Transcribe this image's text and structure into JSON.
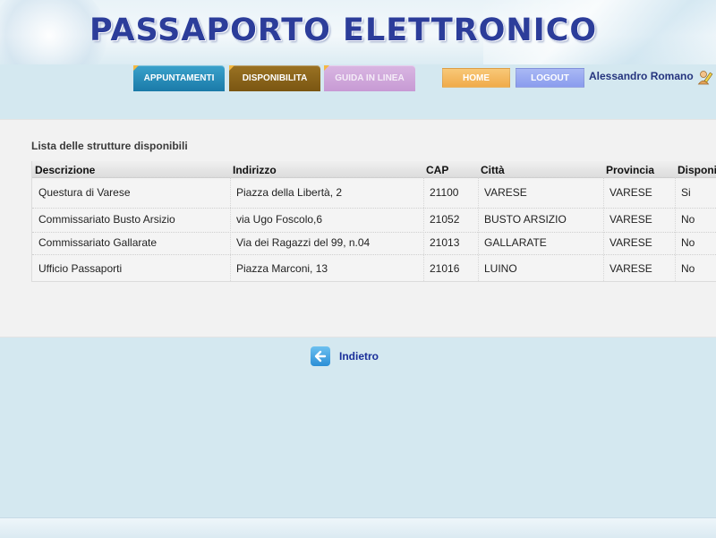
{
  "header": {
    "title": "PASSAPORTO ELETTRONICO"
  },
  "nav": {
    "tabs": [
      "APPUNTAMENTI",
      "DISPONIBILITA",
      "GUIDA IN LINEA"
    ],
    "home_label": "HOME",
    "logout_label": "LOGOUT",
    "user_name": "Alessandro Romano"
  },
  "main": {
    "section_title": "Lista delle strutture disponibili",
    "columns": [
      "Descrizione",
      "Indirizzo",
      "CAP",
      "Città",
      "Provincia",
      "Disponi"
    ],
    "rows": [
      [
        "Questura di Varese",
        "Piazza della Libertà, 2",
        "21100",
        "VARESE",
        "VARESE",
        "Si"
      ],
      [
        "Commissariato Busto Arsizio",
        "via Ugo Foscolo,6",
        "21052",
        "BUSTO ARSIZIO",
        "VARESE",
        "No"
      ],
      [
        "Commissariato Gallarate",
        "Via dei Ragazzi del 99, n.04",
        "21013",
        "GALLARATE",
        "VARESE",
        "No"
      ],
      [
        "Ufficio Passaporti",
        "Piazza Marconi, 13",
        "21016",
        "LUINO",
        "VARESE",
        "No"
      ]
    ]
  },
  "footer": {
    "back_label": "Indietro"
  },
  "icons": {
    "user": "user-pencil-icon",
    "back": "arrow-left-icon"
  },
  "colors": {
    "background": "#d4e8f0",
    "title": "#2c3d9a",
    "tab_appuntamenti": "#1a7aa8",
    "tab_disponibilita": "#7a5612",
    "tab_guida": "#c79ad4",
    "btn_home": "#f0ab4a",
    "btn_logout": "#8a9cee",
    "link": "#1a2f9a"
  }
}
